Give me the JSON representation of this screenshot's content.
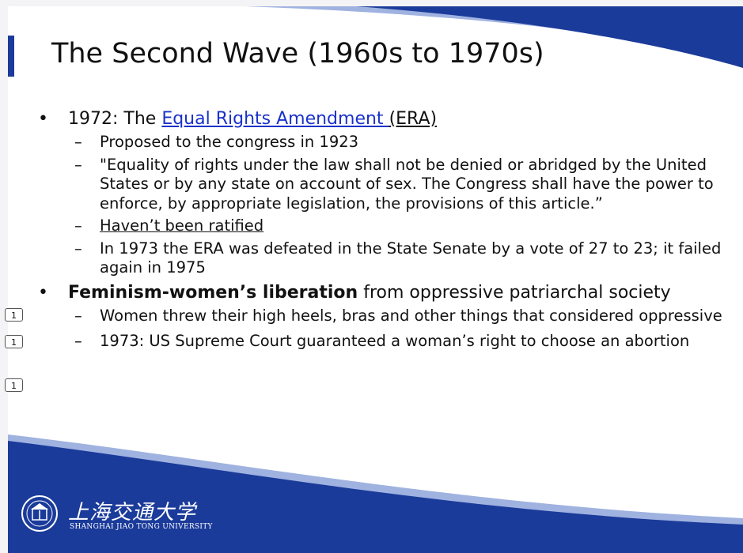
{
  "slide": {
    "title": "The Second Wave (1960s to 1970s)",
    "bullets": [
      {
        "prefix": "1972: The ",
        "link_text": "Equal Rights Amendment ",
        "suffix": "(ERA)",
        "subitems": [
          "Proposed to the congress in 1923",
          "\"Equality of rights under the law shall not be denied or abridged by the United States or by any state on account of sex. The Congress shall have the power to enforce, by appropriate legislation, the provisions of this article.”",
          "Haven’t been ratified",
          "In 1973 the ERA was defeated in the State Senate by a vote of 27 to 23; it failed again in 1975"
        ]
      },
      {
        "bold": "Feminism-women’s liberation",
        "rest": " from oppressive patriarchal society",
        "subitems": [
          "Women threw their high heels, bras and other things that considered oppressive",
          "1973: US Supreme Court guaranteed a woman’s right to choose an abortion"
        ]
      }
    ],
    "bullet_glyph": "•",
    "dash_glyph": "–"
  },
  "markers": [
    "1",
    "1",
    "1"
  ],
  "logo": {
    "name_cn": "上海交通大学",
    "name_en": "SHANGHAI JIAO TONG UNIVERSITY",
    "icon": "university-emblem-icon"
  },
  "colors": {
    "brand_blue": "#1b3b9a",
    "link_blue": "#1a32c9",
    "light_blue": "#9fb2e0"
  }
}
